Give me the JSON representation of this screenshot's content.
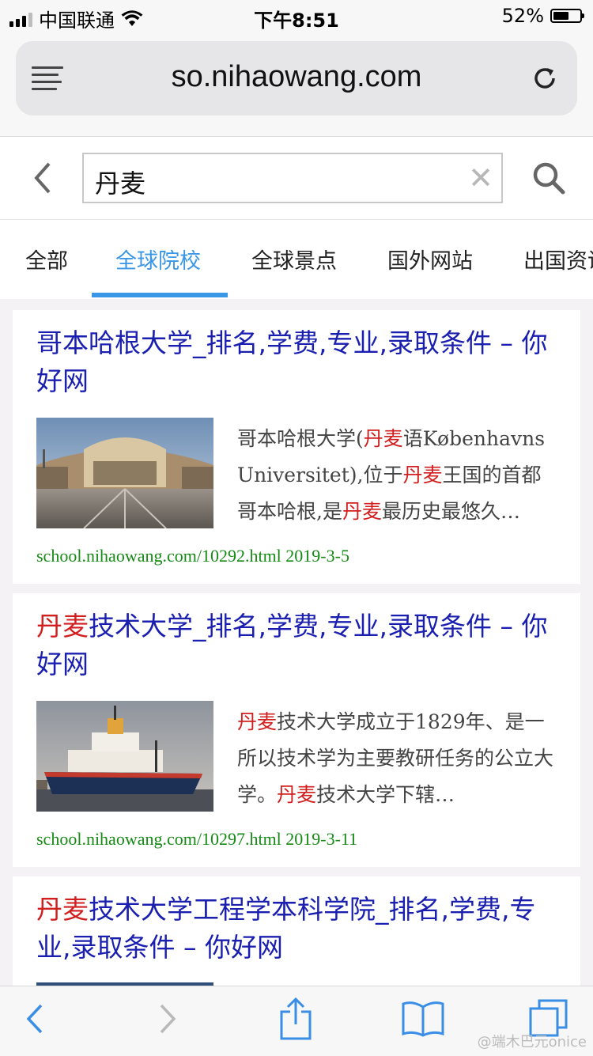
{
  "status_bar": {
    "carrier": "中国联通",
    "time": "下午8:51",
    "battery_percent": "52%",
    "battery_level": 0.52
  },
  "browser": {
    "url": "so.nihaowang.com"
  },
  "search": {
    "query": "丹麦"
  },
  "tabs": [
    {
      "label": "全部",
      "active": false
    },
    {
      "label": "全球院校",
      "active": true
    },
    {
      "label": "全球景点",
      "active": false
    },
    {
      "label": "国外网站",
      "active": false
    },
    {
      "label": "出国资讯",
      "active": false
    }
  ],
  "results": [
    {
      "title_pre": "",
      "title_hl": "",
      "title_post": "哥本哈根大学_排名,学费,专业,录取条件 – 你好网",
      "snippet": [
        {
          "t": "哥本哈根大学(",
          "hl": false
        },
        {
          "t": "丹麦",
          "hl": true
        },
        {
          "t": "语Københavns Universitet),位于",
          "hl": false
        },
        {
          "t": "丹麦",
          "hl": true
        },
        {
          "t": "王国的首都哥本哈根,是",
          "hl": false
        },
        {
          "t": "丹麦",
          "hl": true
        },
        {
          "t": "最历史最悠久…",
          "hl": false
        }
      ],
      "link": "school.nihaowang.com/10292.html 2019-3-5",
      "image": "university-building-photo"
    },
    {
      "title_pre": "",
      "title_hl": "丹麦",
      "title_post": "技术大学_排名,学费,专业,录取条件 – 你好网",
      "snippet": [
        {
          "t": "丹麦",
          "hl": true
        },
        {
          "t": "技术大学成立于1829年、是一所以技术学为主要教研任务的公立大学。",
          "hl": false
        },
        {
          "t": "丹麦",
          "hl": true
        },
        {
          "t": "技术大学下辖…",
          "hl": false
        }
      ],
      "link": "school.nihaowang.com/10297.html 2019-3-11",
      "image": "research-ship-photo"
    },
    {
      "title_pre": "",
      "title_hl": "丹麦",
      "title_post": "技术大学工程学本科学院_排名,学费,专业,录取条件 – 你好网"
    }
  ],
  "watermark": "@端木巴元onice",
  "icons": {
    "back": "chevron-left-icon",
    "forward": "chevron-right-icon",
    "share": "share-icon",
    "bookmarks": "book-icon",
    "tabs": "tabs-icon"
  },
  "colors": {
    "accent": "#3a97e5",
    "title_link": "#1a1fb0",
    "highlight": "#d11f1f",
    "url_green": "#158a15"
  }
}
